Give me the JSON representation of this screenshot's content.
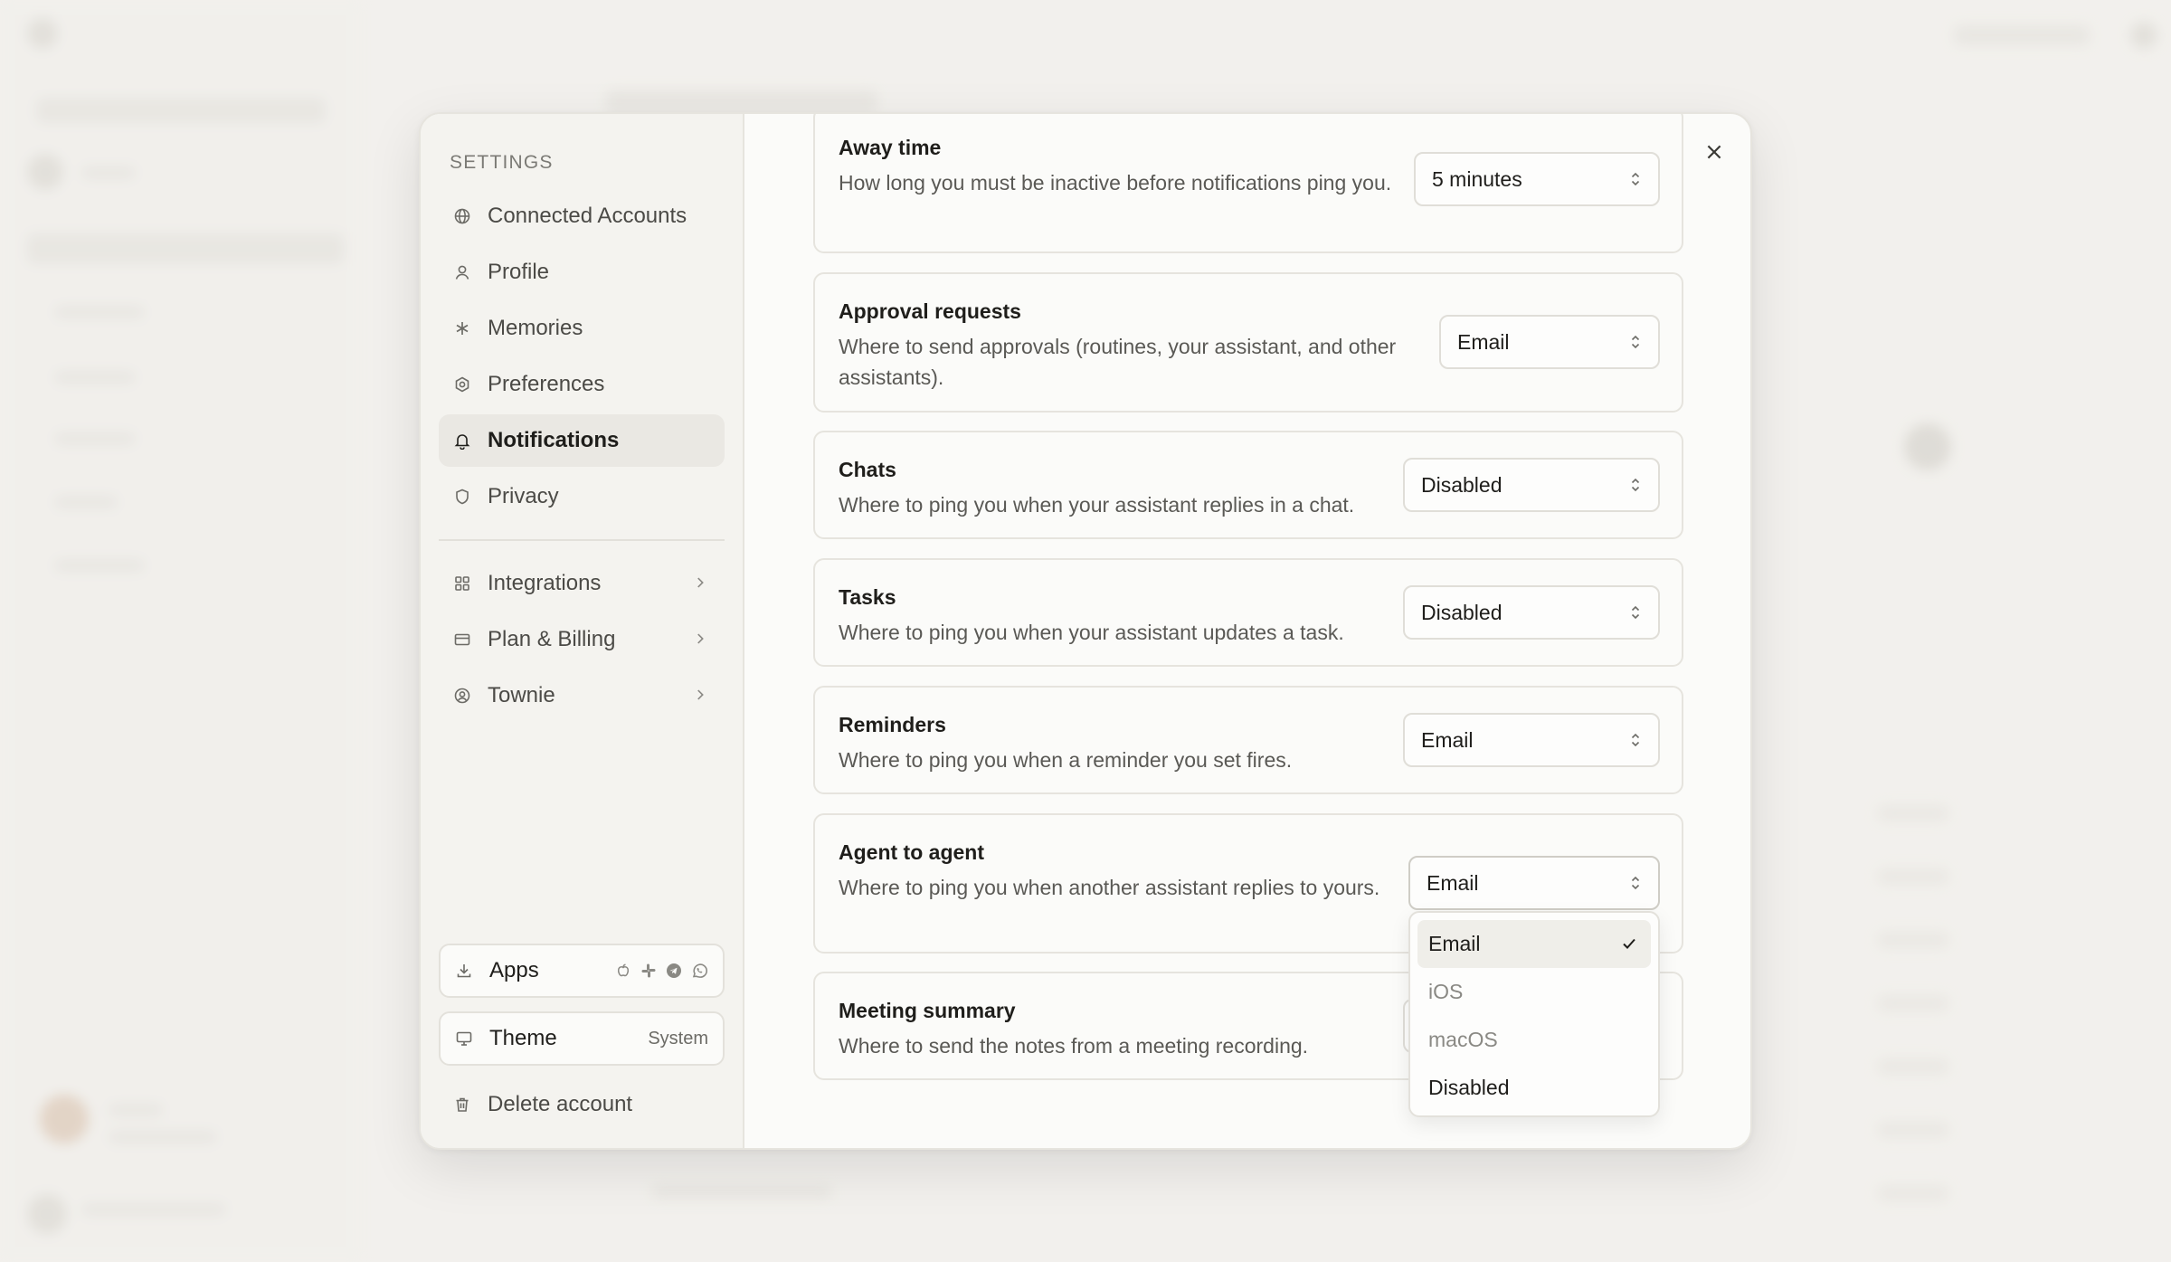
{
  "settings": {
    "heading": "SETTINGS",
    "nav": [
      {
        "label": "Connected Accounts",
        "icon": "globe-icon"
      },
      {
        "label": "Profile",
        "icon": "user-icon"
      },
      {
        "label": "Memories",
        "icon": "asterisk-icon"
      },
      {
        "label": "Preferences",
        "icon": "gear-icon"
      },
      {
        "label": "Notifications",
        "icon": "bell-icon",
        "active": true
      },
      {
        "label": "Privacy",
        "icon": "shield-icon"
      }
    ],
    "nav2": [
      {
        "label": "Integrations",
        "icon": "grid-icon"
      },
      {
        "label": "Plan & Billing",
        "icon": "card-icon"
      },
      {
        "label": "Townie",
        "icon": "avatar-circle-icon"
      }
    ],
    "apps_label": "Apps",
    "theme_label": "Theme",
    "theme_value": "System",
    "delete_label": "Delete account"
  },
  "notifications": [
    {
      "title": "Away time",
      "desc": "How long you must be inactive before notifications ping you.",
      "value": "5 minutes"
    },
    {
      "title": "Approval requests",
      "desc": "Where to send approvals (routines, your assistant, and other assistants).",
      "value": "Email"
    },
    {
      "title": "Chats",
      "desc": "Where to ping you when your assistant replies in a chat.",
      "value": "Disabled"
    },
    {
      "title": "Tasks",
      "desc": "Where to ping you when your assistant updates a task.",
      "value": "Disabled"
    },
    {
      "title": "Reminders",
      "desc": "Where to ping you when a reminder you set fires.",
      "value": "Email"
    },
    {
      "title": "Agent to agent",
      "desc": "Where to ping you when another assistant replies to yours.",
      "value": "Email"
    },
    {
      "title": "Meeting summary",
      "desc": "Where to send the notes from a meeting recording.",
      "value": ""
    }
  ],
  "dropdown": {
    "options": [
      "Email",
      "iOS",
      "macOS",
      "Disabled"
    ],
    "selected": "Email"
  },
  "colors": {
    "background": "#f3f2ee",
    "modal": "#fbfbf9",
    "active_nav": "#eae8e3"
  }
}
